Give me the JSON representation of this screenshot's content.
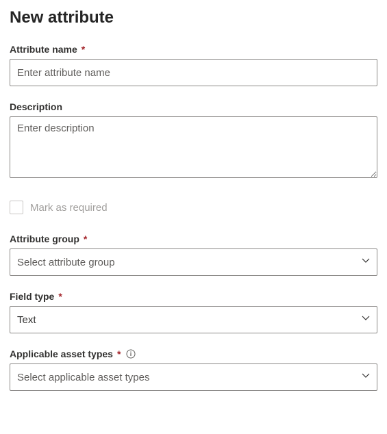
{
  "page_title": "New attribute",
  "fields": {
    "attribute_name": {
      "label": "Attribute name",
      "required": true,
      "placeholder": "Enter attribute name",
      "value": ""
    },
    "description": {
      "label": "Description",
      "required": false,
      "placeholder": "Enter description",
      "value": ""
    },
    "mark_required": {
      "label": "Mark as required",
      "checked": false,
      "disabled": true
    },
    "attribute_group": {
      "label": "Attribute group",
      "required": true,
      "placeholder": "Select attribute group",
      "value": ""
    },
    "field_type": {
      "label": "Field type",
      "required": true,
      "value": "Text"
    },
    "applicable_asset_types": {
      "label": "Applicable asset types",
      "required": true,
      "placeholder": "Select applicable asset types",
      "value": "",
      "has_info": true
    }
  },
  "required_marker": "*"
}
